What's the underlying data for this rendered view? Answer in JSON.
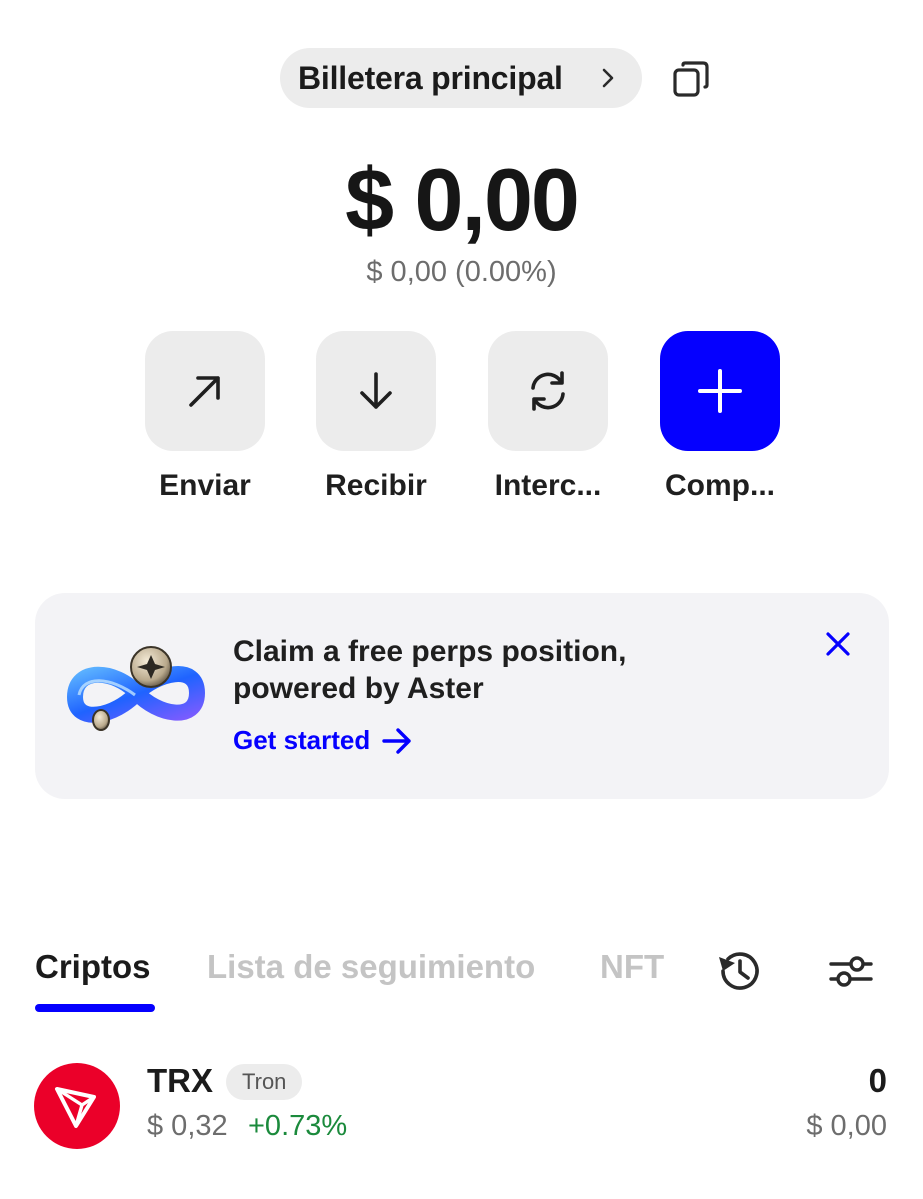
{
  "header": {
    "wallet_name": "Billetera principal"
  },
  "balance": {
    "amount": "$ 0,00",
    "change": "$ 0,00 (0.00%)"
  },
  "actions": [
    {
      "label": "Enviar",
      "icon": "arrow-up-right-icon"
    },
    {
      "label": "Recibir",
      "icon": "arrow-down-icon"
    },
    {
      "label": "Interc...",
      "icon": "swap-icon"
    },
    {
      "label": "Comp...",
      "icon": "plus-icon"
    }
  ],
  "promo": {
    "title": "Claim a free perps position, powered by Aster",
    "cta": "Get started"
  },
  "tabs": [
    {
      "label": "Criptos",
      "active": true
    },
    {
      "label": "Lista de seguimiento",
      "active": false
    },
    {
      "label": "NFT",
      "active": false
    }
  ],
  "assets": [
    {
      "symbol": "TRX",
      "network": "Tron",
      "price": "$ 0,32",
      "change": "+0.73%",
      "amount": "0",
      "value": "$ 0,00"
    }
  ],
  "colors": {
    "accent": "#0500ff",
    "positive": "#1b8a3c",
    "tron": "#eb0029"
  }
}
